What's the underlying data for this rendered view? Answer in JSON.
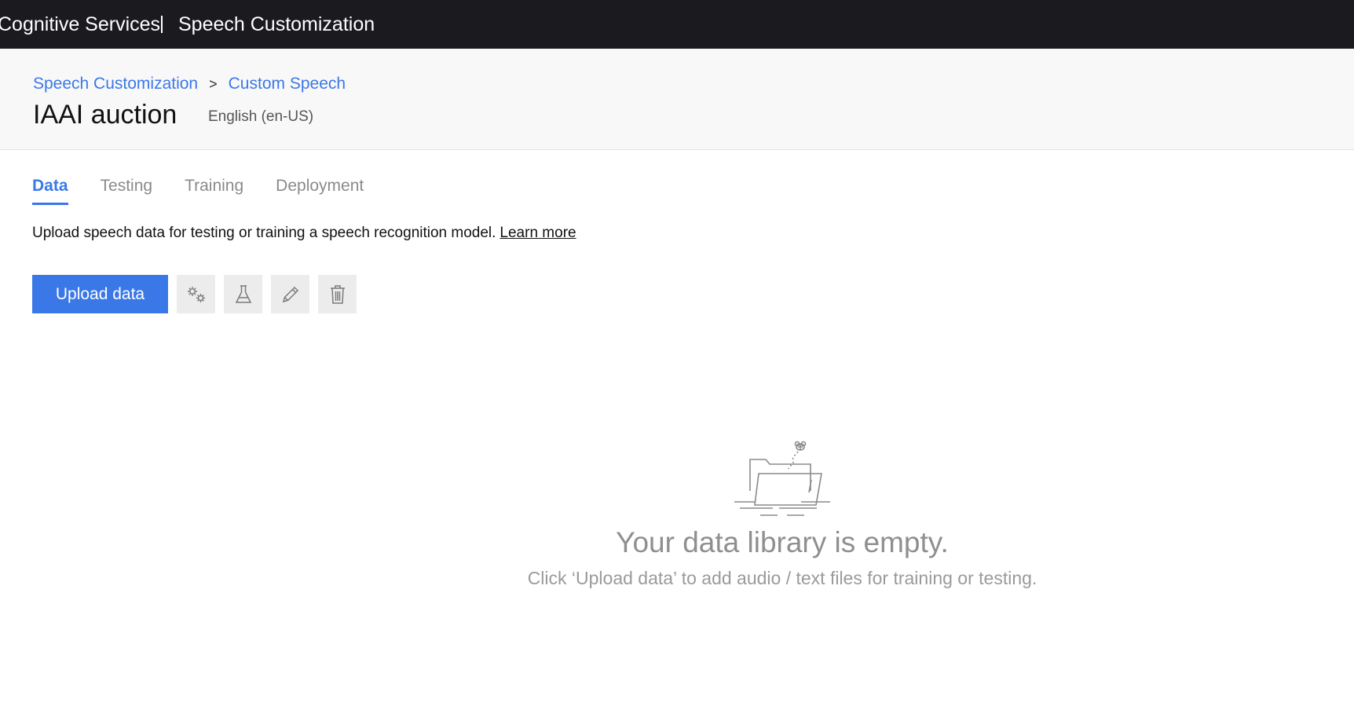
{
  "topbar": {
    "brand": "Cognitive Services",
    "product": "Speech Customization"
  },
  "breadcrumb": {
    "items": [
      "Speech Customization",
      "Custom Speech"
    ],
    "separator": ">"
  },
  "project": {
    "title": "IAAI auction",
    "locale": "English (en-US)"
  },
  "tabs": [
    {
      "label": "Data",
      "active": true
    },
    {
      "label": "Testing",
      "active": false
    },
    {
      "label": "Training",
      "active": false
    },
    {
      "label": "Deployment",
      "active": false
    }
  ],
  "description": {
    "text": "Upload speech data for testing or training a speech recognition model.",
    "link": "Learn more"
  },
  "toolbar": {
    "upload_label": "Upload data",
    "icons": [
      "gears-icon",
      "flask-icon",
      "pencil-icon",
      "trash-icon"
    ]
  },
  "empty_state": {
    "title": "Your data library is empty.",
    "subtitle": "Click ‘Upload data’ to add audio / text files for training or testing.",
    "illustration": "empty-folder-icon"
  },
  "colors": {
    "topbar_bg": "#1b1a1f",
    "accent": "#3b78e7",
    "header_bg": "#f8f8f8"
  }
}
